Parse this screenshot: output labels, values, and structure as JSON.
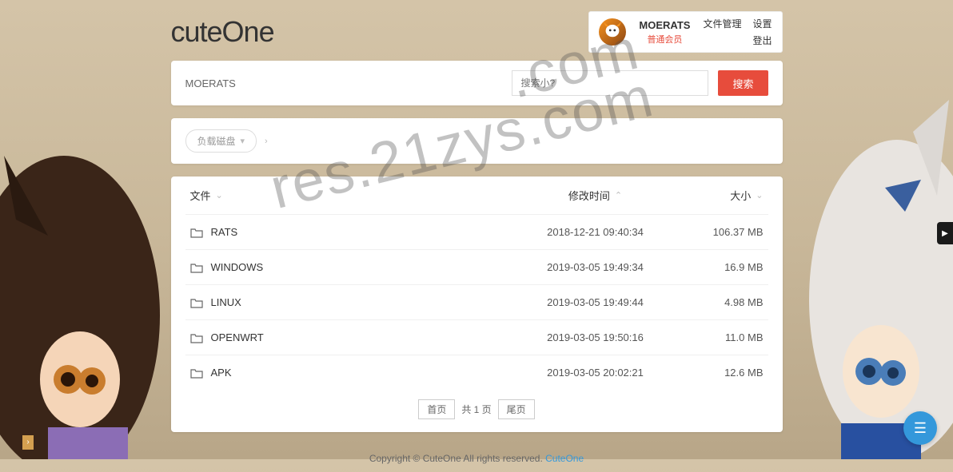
{
  "logo": "cuteOne",
  "user": {
    "name": "MOERATS",
    "rank": "普通会员"
  },
  "nav": {
    "files": "文件管理",
    "settings": "设置",
    "logout": "登出"
  },
  "search": {
    "breadcrumb": "MOERATS",
    "placeholder": "搜索小?",
    "button": "搜索"
  },
  "disk": {
    "label": "负载磁盘"
  },
  "columns": {
    "name": "文件",
    "date": "修改时间",
    "size": "大小"
  },
  "rows": [
    {
      "name": "RATS",
      "date": "2018-12-21 09:40:34",
      "size": "106.37 MB"
    },
    {
      "name": "WINDOWS",
      "date": "2019-03-05 19:49:34",
      "size": "16.9 MB"
    },
    {
      "name": "LINUX",
      "date": "2019-03-05 19:49:44",
      "size": "4.98 MB"
    },
    {
      "name": "OPENWRT",
      "date": "2019-03-05 19:50:16",
      "size": "11.0 MB"
    },
    {
      "name": "APK",
      "date": "2019-03-05 20:02:21",
      "size": "12.6 MB"
    }
  ],
  "pager": {
    "first": "首页",
    "info": "共 1 页",
    "last": "尾页"
  },
  "footer": {
    "text": "Copyright © CuteOne All rights reserved. ",
    "link": "CuteOne"
  },
  "watermark": "res.21zys.com"
}
